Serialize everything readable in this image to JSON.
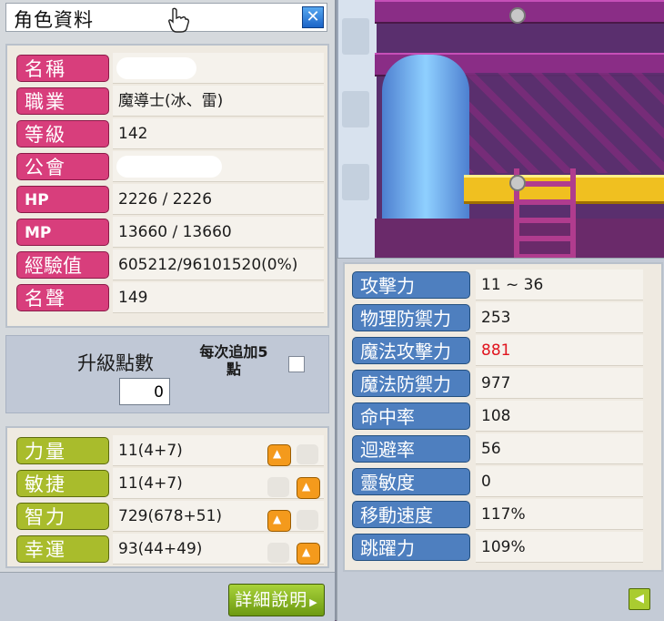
{
  "window": {
    "title": "角色資料",
    "close_symbol": "✕"
  },
  "info": {
    "rows": [
      {
        "label": "名稱",
        "value": "",
        "blank": true,
        "style": "pink"
      },
      {
        "label": "職業",
        "value": "魔導士(冰、雷)",
        "style": "pink"
      },
      {
        "label": "等級",
        "value": "142",
        "style": "pink"
      },
      {
        "label": "公會",
        "value": "",
        "blank": true,
        "style": "pink"
      },
      {
        "label": "HP",
        "value": "2226 / 2226",
        "style": "pink"
      },
      {
        "label": "MP",
        "value": "13660 / 13660",
        "style": "pink"
      },
      {
        "label": "經驗值",
        "value": "605212/96101520(0%)",
        "style": "pink"
      },
      {
        "label": "名聲",
        "value": "149",
        "style": "pink"
      }
    ]
  },
  "ap": {
    "label": "升級點數",
    "value": "0",
    "auto_label_line1": "每次追加5",
    "auto_label_line2": "點",
    "auto_checked": false
  },
  "stats": {
    "rows": [
      {
        "label": "力量",
        "value": "11(4+7)",
        "btn1_on": true,
        "btn2_on": false
      },
      {
        "label": "敏捷",
        "value": "11(4+7)",
        "btn1_on": false,
        "btn2_on": true
      },
      {
        "label": "智力",
        "value": "729(678+51)",
        "btn1_on": true,
        "btn2_on": false
      },
      {
        "label": "幸運",
        "value": "93(44+49)",
        "btn1_on": false,
        "btn2_on": true
      }
    ]
  },
  "detail_button": "詳細說明",
  "detail_arrow": "▶",
  "combat": {
    "rows": [
      {
        "label": "攻擊力",
        "value": "11 ~ 36"
      },
      {
        "label": "物理防禦力",
        "value": "253"
      },
      {
        "label": "魔法攻擊力",
        "value": "881",
        "highlight": true
      },
      {
        "label": "魔法防禦力",
        "value": "977"
      },
      {
        "label": "命中率",
        "value": "108"
      },
      {
        "label": "迴避率",
        "value": "56"
      },
      {
        "label": "靈敏度",
        "value": "0"
      },
      {
        "label": "移動速度",
        "value": "117%"
      },
      {
        "label": "跳躍力",
        "value": "109%"
      }
    ]
  },
  "back_symbol": "◀",
  "colors": {
    "label_pink": "#d83e7c",
    "label_green": "#a9bc2c",
    "label_blue": "#4e7fbf",
    "highlight_red": "#e0141e",
    "button_orange": "#f49a1c"
  }
}
